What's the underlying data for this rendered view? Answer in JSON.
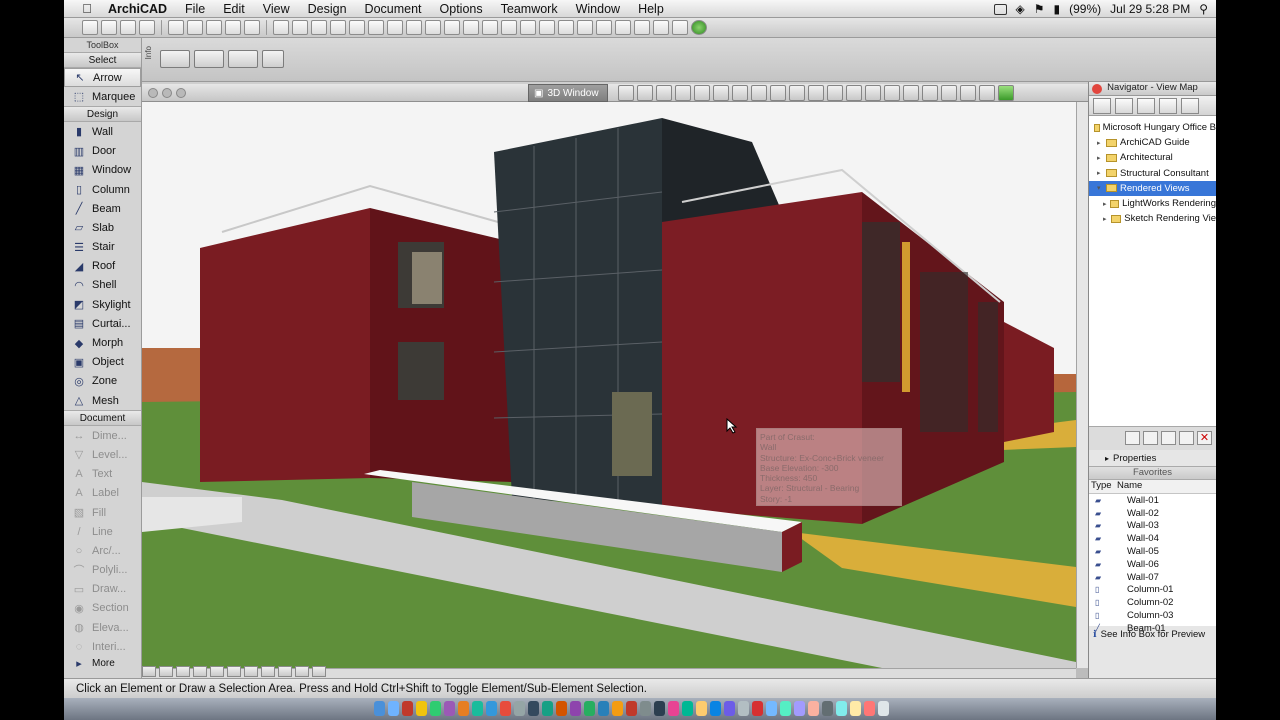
{
  "menu": {
    "app_name": "ArchiCAD",
    "items": [
      "File",
      "Edit",
      "View",
      "Design",
      "Document",
      "Options",
      "Teamwork",
      "Window",
      "Help"
    ],
    "battery": "(99%)",
    "clock": "Jul 29  5:28 PM"
  },
  "toolbox": {
    "title": "ToolBox",
    "select_label": "Select",
    "tools_select": [
      {
        "label": "Arrow",
        "icon": "arrow-icon"
      },
      {
        "label": "Marquee",
        "icon": "marquee-icon"
      }
    ],
    "design_header": "Design",
    "tools_design": [
      {
        "label": "Wall",
        "icon": "wall-icon"
      },
      {
        "label": "Door",
        "icon": "door-icon"
      },
      {
        "label": "Window",
        "icon": "window-icon"
      },
      {
        "label": "Column",
        "icon": "column-icon"
      },
      {
        "label": "Beam",
        "icon": "beam-icon"
      },
      {
        "label": "Slab",
        "icon": "slab-icon"
      },
      {
        "label": "Stair",
        "icon": "stair-icon"
      },
      {
        "label": "Roof",
        "icon": "roof-icon"
      },
      {
        "label": "Shell",
        "icon": "shell-icon"
      },
      {
        "label": "Skylight",
        "icon": "skylight-icon"
      },
      {
        "label": "Curtai...",
        "icon": "curtain-wall-icon"
      },
      {
        "label": "Morph",
        "icon": "morph-icon"
      },
      {
        "label": "Object",
        "icon": "object-icon"
      },
      {
        "label": "Zone",
        "icon": "zone-icon"
      },
      {
        "label": "Mesh",
        "icon": "mesh-icon"
      }
    ],
    "document_header": "Document",
    "tools_document": [
      {
        "label": "Dime...",
        "icon": "dimension-icon"
      },
      {
        "label": "Level...",
        "icon": "level-dimension-icon"
      },
      {
        "label": "Text",
        "icon": "text-icon"
      },
      {
        "label": "Label",
        "icon": "label-icon"
      },
      {
        "label": "Fill",
        "icon": "fill-icon"
      },
      {
        "label": "Line",
        "icon": "line-icon"
      },
      {
        "label": "Arc/...",
        "icon": "arc-icon"
      },
      {
        "label": "Polyli...",
        "icon": "polyline-icon"
      },
      {
        "label": "Draw...",
        "icon": "drawing-icon"
      },
      {
        "label": "Section",
        "icon": "section-icon"
      },
      {
        "label": "Eleva...",
        "icon": "elevation-icon"
      },
      {
        "label": "Interi...",
        "icon": "interior-elevation-icon"
      }
    ],
    "more_label": "More"
  },
  "window3d": {
    "tab_label": "3D Window"
  },
  "infotip": {
    "lines": [
      "Part of Crasut:",
      "Wall",
      "Structure: Ex-Conc+Brick veneer",
      "Base Elevation: -300",
      "Thickness: 450",
      "Layer: Structural - Bearing",
      "Story: -1"
    ]
  },
  "navigator": {
    "title": "Navigator - View Map",
    "tree": [
      {
        "label": "Microsoft Hungary Office B",
        "depth": 0,
        "type": "root",
        "selected": false
      },
      {
        "label": "ArchiCAD Guide",
        "depth": 1,
        "type": "folder",
        "selected": false
      },
      {
        "label": "Architectural",
        "depth": 1,
        "type": "folder",
        "selected": false
      },
      {
        "label": "Structural Consultant",
        "depth": 1,
        "type": "folder",
        "selected": false
      },
      {
        "label": "Rendered Views",
        "depth": 1,
        "type": "folder",
        "selected": true
      },
      {
        "label": "LightWorks Rendering",
        "depth": 2,
        "type": "folder",
        "selected": false
      },
      {
        "label": "Sketch Rendering Vie",
        "depth": 2,
        "type": "folder",
        "selected": false
      }
    ],
    "properties_label": "Properties",
    "favorites_label": "Favorites",
    "fav_columns": [
      "Type",
      "Name"
    ],
    "favorites": [
      {
        "name": "Wall-01",
        "icon": "wall-icon"
      },
      {
        "name": "Wall-02",
        "icon": "wall-icon"
      },
      {
        "name": "Wall-03",
        "icon": "wall-icon"
      },
      {
        "name": "Wall-04",
        "icon": "wall-icon"
      },
      {
        "name": "Wall-05",
        "icon": "wall-icon"
      },
      {
        "name": "Wall-06",
        "icon": "wall-icon"
      },
      {
        "name": "Wall-07",
        "icon": "wall-icon"
      },
      {
        "name": "Column-01",
        "icon": "column-icon"
      },
      {
        "name": "Column-02",
        "icon": "column-icon"
      },
      {
        "name": "Column-03",
        "icon": "column-icon"
      },
      {
        "name": "Beam-01",
        "icon": "beam-icon"
      }
    ],
    "see_info": "See Info Box for Preview"
  },
  "status": {
    "message": "Click an Element or Draw a Selection Area. Press and Hold Ctrl+Shift to Toggle Element/Sub-Element Selection."
  },
  "colors": {
    "brick": "#7a1c22",
    "grass": "#5f8f3a",
    "walkway": "#d9ae3a",
    "sky": "#f4f4f4",
    "selection": "#3876d8"
  }
}
